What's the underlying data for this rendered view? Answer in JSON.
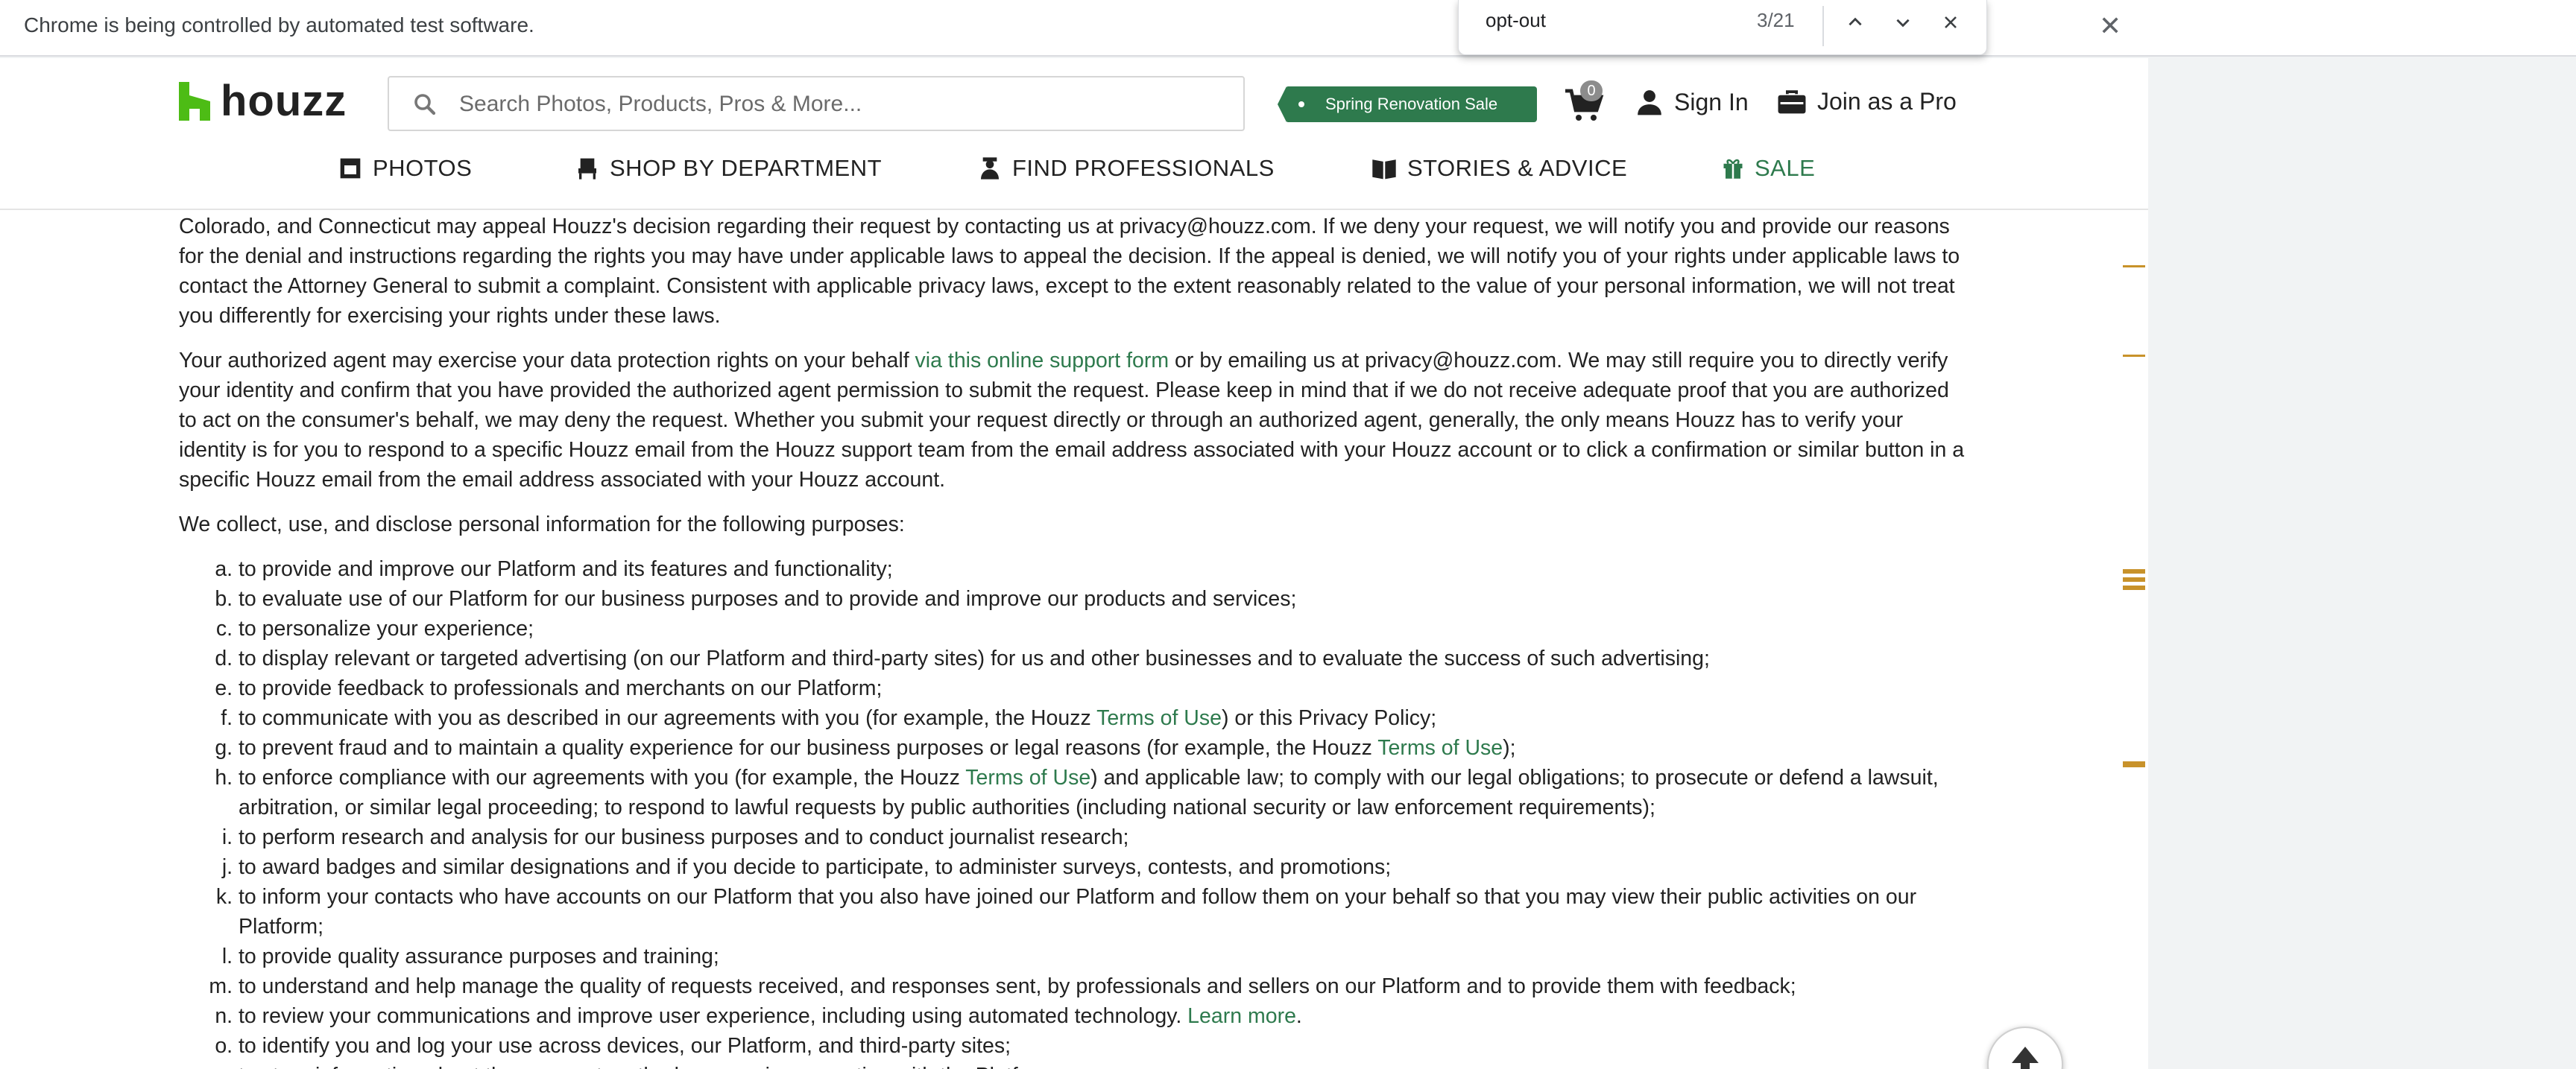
{
  "infobar": {
    "message": "Chrome is being controlled by automated test software."
  },
  "findbar": {
    "query": "opt-out",
    "count": "3/21"
  },
  "header": {
    "logo_text": "houzz",
    "search_placeholder": "Search Photos, Products, Pros & More...",
    "sale_badge": "Spring Renovation Sale",
    "cart_count": "0",
    "sign_in": "Sign In",
    "join_pro": "Join as a Pro"
  },
  "nav": {
    "photos": "PHOTOS",
    "shop": "SHOP BY DEPARTMENT",
    "find_pros": "FIND PROFESSIONALS",
    "stories": "STORIES & ADVICE",
    "sale": "SALE"
  },
  "content": {
    "p1": "Colorado, and Connecticut may appeal Houzz's decision regarding their request by contacting us at privacy@houzz.com. If we deny your request, we will notify you and provide our reasons for the denial and instructions regarding the rights you may have under applicable laws to appeal the decision. If the appeal is denied, we will notify you of your rights under applicable laws to contact the Attorney General to submit a complaint. Consistent with applicable privacy laws, except to the extent reasonably related to the value of your personal information, we will not treat you differently for exercising your rights under these laws.",
    "p2_before": "Your authorized agent may exercise your data protection rights on your behalf ",
    "p2_link": "via this online support form",
    "p2_after": " or by emailing us at privacy@houzz.com. We may still require you to directly verify your identity and confirm that you have provided the authorized agent permission to submit the request. Please keep in mind that if we do not receive adequate proof that you are authorized to act on the consumer's behalf, we may deny the request. Whether you submit your request directly or through an authorized agent, generally, the only means Houzz has to verify your identity is for you to respond to a specific Houzz email from the Houzz support team from the email address associated with your Houzz account or to click a confirmation or similar button in a specific Houzz email from the email address associated with your Houzz account.",
    "p3": "We collect, use, and disclose personal information for the following purposes:",
    "terms_link": "Terms of Use",
    "learn_more": "Learn more",
    "items": {
      "a": "to provide and improve our Platform and its features and functionality;",
      "b": "to evaluate use of our Platform for our business purposes and to provide and improve our products and services;",
      "c": "to personalize your experience;",
      "d": "to display relevant or targeted advertising (on our Platform and third-party sites) for us and other businesses and to evaluate the success of such advertising;",
      "e": "to provide feedback to professionals and merchants on our Platform;",
      "f_before": "to communicate with you as described in our agreements with you (for example, the Houzz ",
      "f_after": ") or this Privacy Policy;",
      "g_before": "to prevent fraud and to maintain a quality experience for our business purposes or legal reasons (for example, the Houzz ",
      "g_after": ");",
      "h_before": "to enforce compliance with our agreements with you (for example, the Houzz ",
      "h_after": ") and applicable law; to comply with our legal obligations; to prosecute or defend a lawsuit, arbitration, or similar legal proceeding; to respond to lawful requests by public authorities (including national security or law enforcement requirements);",
      "i": "to perform research and analysis for our business purposes and to conduct journalist research;",
      "j": "to award badges and similar designations and if you decide to participate, to administer surveys, contests, and promotions;",
      "k": "to inform your contacts who have accounts on our Platform that you also have joined our Platform and follow them on your behalf so that you may view their public activities on our Platform;",
      "l": "to provide quality assurance purposes and training;",
      "m": "to understand and help manage the quality of requests received, and responses sent, by professionals and sellers on our Platform and to provide them with feedback;",
      "n_before": "to review your communications and improve user experience, including using automated technology. ",
      "n_after": ".",
      "o": "to identify you and log your use across devices, our Platform, and third-party sites;",
      "p": "to store information about the payment method you use in connection with the Platform;"
    }
  }
}
